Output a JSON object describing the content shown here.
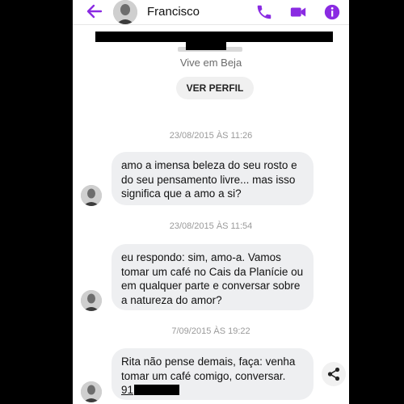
{
  "header": {
    "contact_name": "Francisco"
  },
  "profile": {
    "location": "Vive em Beja",
    "view_profile_label": "VER PERFIL"
  },
  "messages": [
    {
      "timestamp": "23/08/2015 ÀS 11:26",
      "text": "amo a imensa beleza do seu rosto e do seu pensamento livre... mas isso significa que a amo a si?"
    },
    {
      "timestamp": "23/08/2015 ÀS 11:54",
      "text": "eu respondo: sim, amo-a. Vamos tomar um café no Cais da Planície ou em qualquer parte e conversar sobre a natureza do amor?"
    },
    {
      "timestamp": "7/09/2015 ÀS 19:22",
      "text": "Rita não pense demais, faça: venha tomar um café comigo, conversar.",
      "phone_prefix": "91"
    }
  ],
  "colors": {
    "accent": "#8a2be2",
    "bubble": "#eeeff1",
    "background": "#000000"
  },
  "icons": [
    "back-arrow-icon",
    "phone-icon",
    "video-camera-icon",
    "info-icon",
    "share-icon"
  ]
}
